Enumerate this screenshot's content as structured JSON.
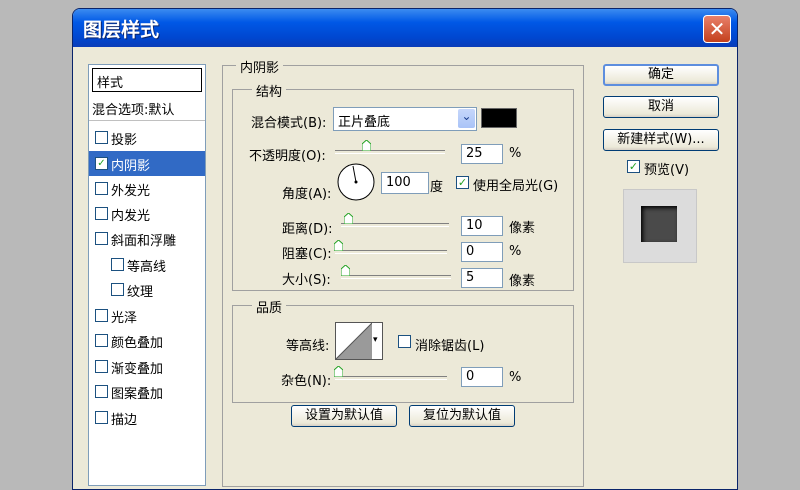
{
  "window": {
    "title": "图层样式",
    "close_glyph": "✕"
  },
  "sidebar": {
    "header": "样式",
    "blend_options": "混合选项:默认",
    "items": [
      {
        "label": "投影",
        "checked": false,
        "selected": false
      },
      {
        "label": "内阴影",
        "checked": true,
        "selected": true
      },
      {
        "label": "外发光",
        "checked": false
      },
      {
        "label": "内发光",
        "checked": false
      },
      {
        "label": "斜面和浮雕",
        "checked": false
      },
      {
        "label": "等高线",
        "checked": false
      },
      {
        "label": "纹理",
        "checked": false
      },
      {
        "label": "光泽",
        "checked": false
      },
      {
        "label": "颜色叠加",
        "checked": false
      },
      {
        "label": "渐变叠加",
        "checked": false
      },
      {
        "label": "图案叠加",
        "checked": false
      },
      {
        "label": "描边",
        "checked": false
      }
    ]
  },
  "panel": {
    "title": "内阴影",
    "structure": {
      "title": "结构",
      "blend_mode_label": "混合模式(B):",
      "blend_mode_value": "正片叠底",
      "shadow_color": "#000000",
      "opacity_label": "不透明度(O):",
      "opacity_value": "25",
      "opacity_unit": "%",
      "angle_label": "角度(A):",
      "angle_value": "100",
      "angle_unit": "度",
      "global_light_label": "使用全局光(G)",
      "global_light_checked": true,
      "distance_label": "距离(D):",
      "distance_value": "10",
      "distance_unit": "像素",
      "choke_label": "阻塞(C):",
      "choke_value": "0",
      "choke_unit": "%",
      "size_label": "大小(S):",
      "size_value": "5",
      "size_unit": "像素"
    },
    "quality": {
      "title": "品质",
      "contour_label": "等高线:",
      "antialias_label": "消除锯齿(L)",
      "antialias_checked": false,
      "noise_label": "杂色(N):",
      "noise_value": "0",
      "noise_unit": "%"
    },
    "make_default": "设置为默认值",
    "reset_default": "复位为默认值"
  },
  "buttons": {
    "ok": "确定",
    "cancel": "取消",
    "new_style": "新建样式(W)...",
    "preview_label": "预览(V)",
    "preview_checked": true
  },
  "check_glyph": "✓",
  "dropdown_glyph": "⌄"
}
